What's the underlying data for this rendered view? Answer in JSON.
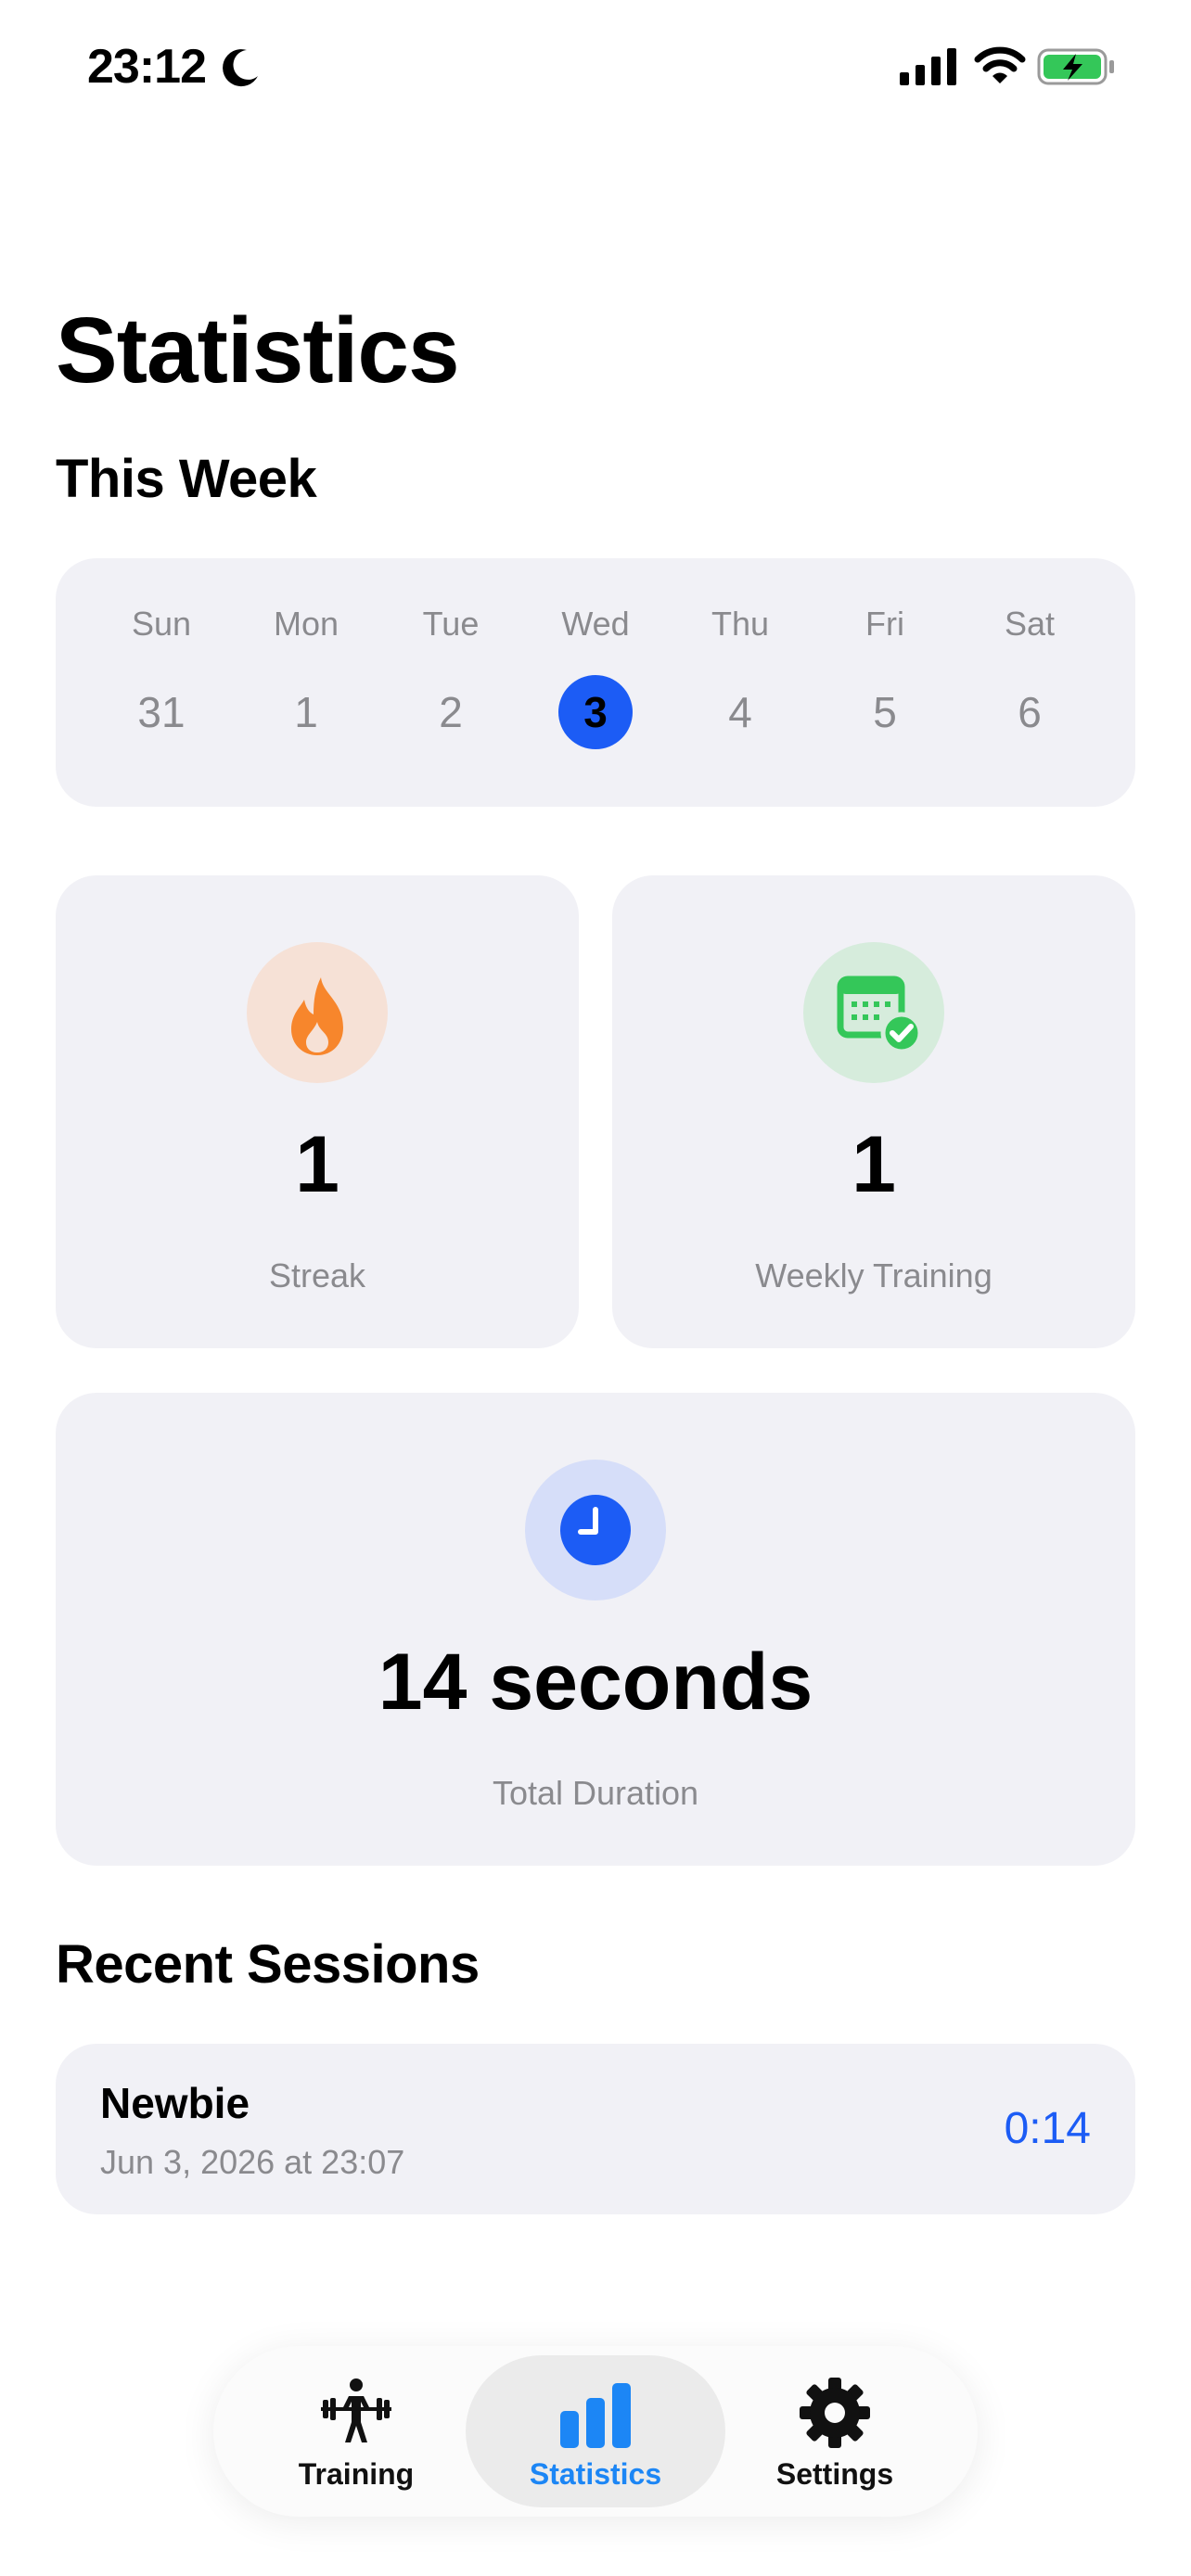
{
  "status_bar": {
    "time": "23:12"
  },
  "page": {
    "title": "Statistics"
  },
  "this_week": {
    "title": "This Week",
    "days": [
      {
        "name": "Sun",
        "date": "31",
        "selected": false
      },
      {
        "name": "Mon",
        "date": "1",
        "selected": false
      },
      {
        "name": "Tue",
        "date": "2",
        "selected": false
      },
      {
        "name": "Wed",
        "date": "3",
        "selected": true
      },
      {
        "name": "Thu",
        "date": "4",
        "selected": false
      },
      {
        "name": "Fri",
        "date": "5",
        "selected": false
      },
      {
        "name": "Sat",
        "date": "6",
        "selected": false
      }
    ]
  },
  "stats": {
    "streak": {
      "value": "1",
      "label": "Streak",
      "icon": "flame-icon",
      "color": "#f7862c"
    },
    "weekly": {
      "value": "1",
      "label": "Weekly Training",
      "icon": "calendar-check-icon",
      "color": "#34c759"
    },
    "duration": {
      "value": "14 seconds",
      "label": "Total Duration",
      "icon": "clock-icon",
      "color": "#1c5cf5"
    }
  },
  "recent": {
    "title": "Recent Sessions",
    "sessions": [
      {
        "name": "Newbie",
        "date": "Jun 3, 2026 at 23:07",
        "duration": "0:14"
      }
    ]
  },
  "tabs": [
    {
      "label": "Training",
      "icon": "weightlifter-icon",
      "active": false
    },
    {
      "label": "Statistics",
      "icon": "bar-chart-icon",
      "active": true
    },
    {
      "label": "Settings",
      "icon": "gear-icon",
      "active": false
    }
  ],
  "colors": {
    "accent": "#1c5cf5",
    "card_bg": "#f1f1f6",
    "secondary_text": "#8a8a8e"
  }
}
